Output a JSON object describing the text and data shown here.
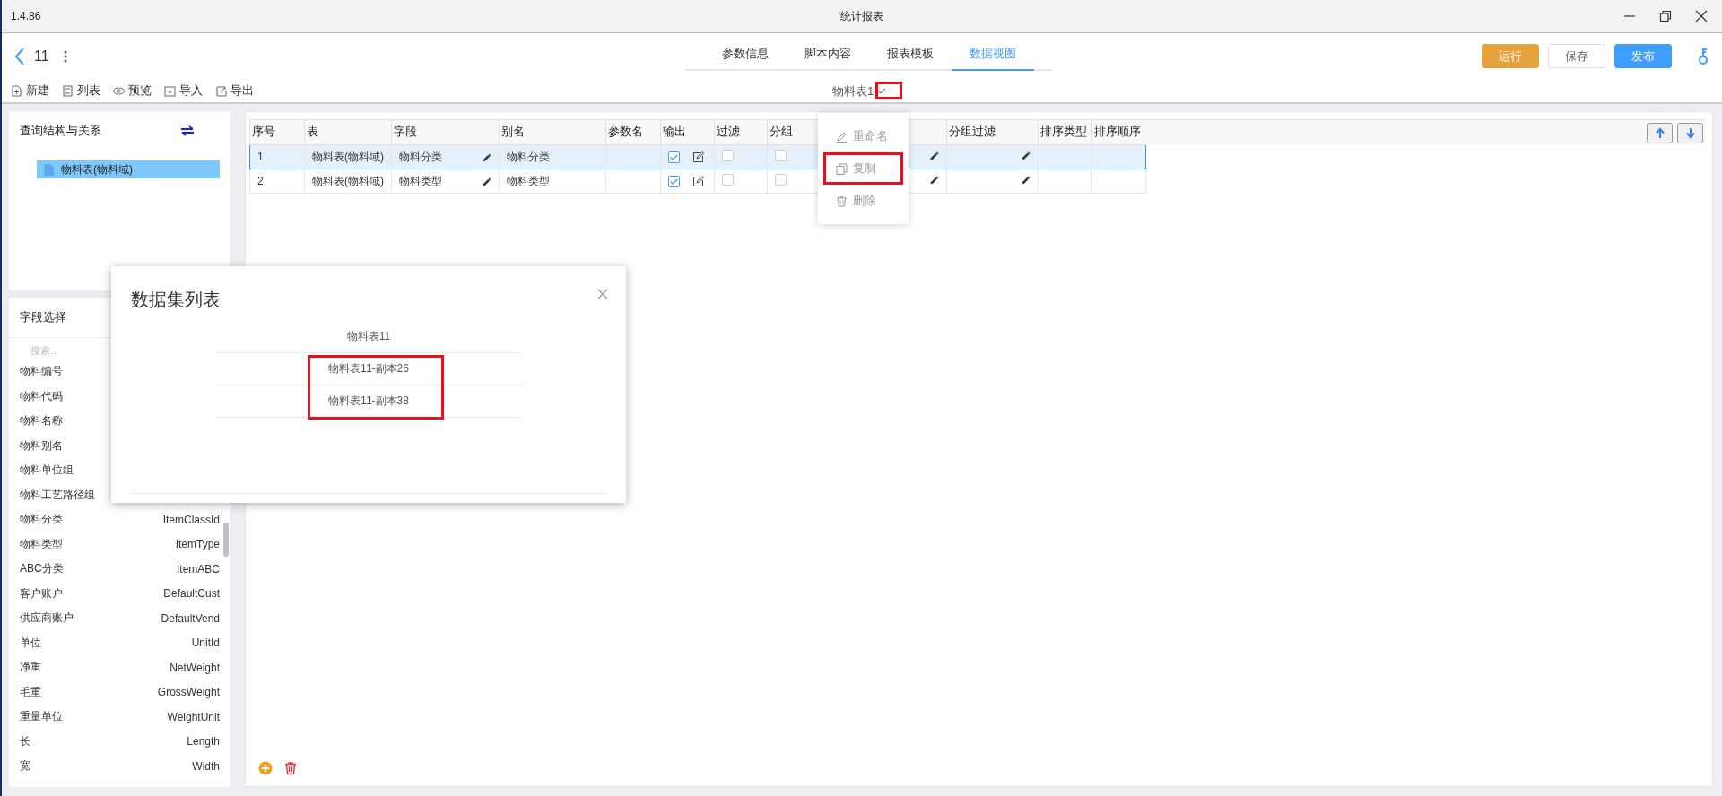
{
  "window": {
    "version": "1.4.86",
    "title": "统计报表"
  },
  "header": {
    "back_label": "11",
    "tabs": [
      {
        "label": "参数信息",
        "selected": false
      },
      {
        "label": "脚本内容",
        "selected": false
      },
      {
        "label": "报表模板",
        "selected": false
      },
      {
        "label": "数据视图",
        "selected": true
      }
    ],
    "buttons": [
      {
        "label": "运行",
        "kind": "warning"
      },
      {
        "label": "保存",
        "kind": "default"
      },
      {
        "label": "发布",
        "kind": "primary"
      }
    ]
  },
  "toolbar": [
    {
      "label": "新建",
      "kind": "new"
    },
    {
      "label": "列表",
      "kind": "list"
    },
    {
      "label": "预览",
      "kind": "preview"
    },
    {
      "label": "导入",
      "kind": "import"
    },
    {
      "label": "导出",
      "kind": "export"
    }
  ],
  "dataset_selector": {
    "value": "物料表1",
    "highlighted": true
  },
  "structure_panel": {
    "title": "查询结构与关系",
    "items": [
      {
        "label": "物料表(物料域)",
        "selected": true
      }
    ]
  },
  "field_panel": {
    "title": "字段选择",
    "search": {
      "placeholder": "搜索..."
    },
    "fields": [
      {
        "label": "物料编号"
      },
      {
        "label": "物料代码"
      },
      {
        "label": "物料名称"
      },
      {
        "label": "物料别名"
      },
      {
        "label": "物料单位组"
      },
      {
        "label": "物料工艺路径组"
      },
      {
        "label": "物料分类",
        "code": "ItemClassId"
      },
      {
        "label": "物料类型",
        "code": "ItemType"
      },
      {
        "label": "ABC分类",
        "code": "ItemABC"
      },
      {
        "label": "客户账户",
        "code": "DefaultCust"
      },
      {
        "label": "供应商账户",
        "code": "DefaultVend"
      },
      {
        "label": "单位",
        "code": "UnitId"
      },
      {
        "label": "净重",
        "code": "NetWeight"
      },
      {
        "label": "毛重",
        "code": "GrossWeight"
      },
      {
        "label": "重量单位",
        "code": "WeightUnit"
      },
      {
        "label": "长",
        "code": "Length"
      },
      {
        "label": "宽",
        "code": "Width"
      }
    ]
  },
  "table": {
    "columns": [
      {
        "label": "序号"
      },
      {
        "label": "表"
      },
      {
        "label": "字段"
      },
      {
        "label": "别名"
      },
      {
        "label": "参数名"
      },
      {
        "label": "输出"
      },
      {
        "label": "过滤"
      },
      {
        "label": "分组"
      },
      {},
      {
        "label": "分组过滤"
      },
      {
        "label": "排序类型"
      },
      {
        "label": "排序顺序"
      }
    ],
    "rows": [
      {
        "selected": true,
        "index": "1",
        "table": "物料表(物料域)",
        "field": "物料分类",
        "alias": "物料分类",
        "output": true,
        "filter": false,
        "group": false
      },
      {
        "selected": false,
        "index": "2",
        "table": "物料表(物料域)",
        "field": "物料类型",
        "alias": "物料类型",
        "output": true,
        "filter": false,
        "group": false
      }
    ]
  },
  "context_menu": {
    "items": [
      {
        "label": "重命名",
        "kind": "rename",
        "highlighted": false
      },
      {
        "label": "复制",
        "kind": "copy",
        "highlighted": true
      },
      {
        "label": "删除",
        "kind": "delete",
        "highlighted": false
      }
    ]
  },
  "dialog": {
    "title": "数据集列表",
    "items": [
      {
        "label": "物料表11",
        "highlighted": false
      },
      {
        "label": "物料表11-副本26",
        "highlighted": true
      },
      {
        "label": "物料表11-副本38",
        "highlighted": true
      }
    ]
  }
}
